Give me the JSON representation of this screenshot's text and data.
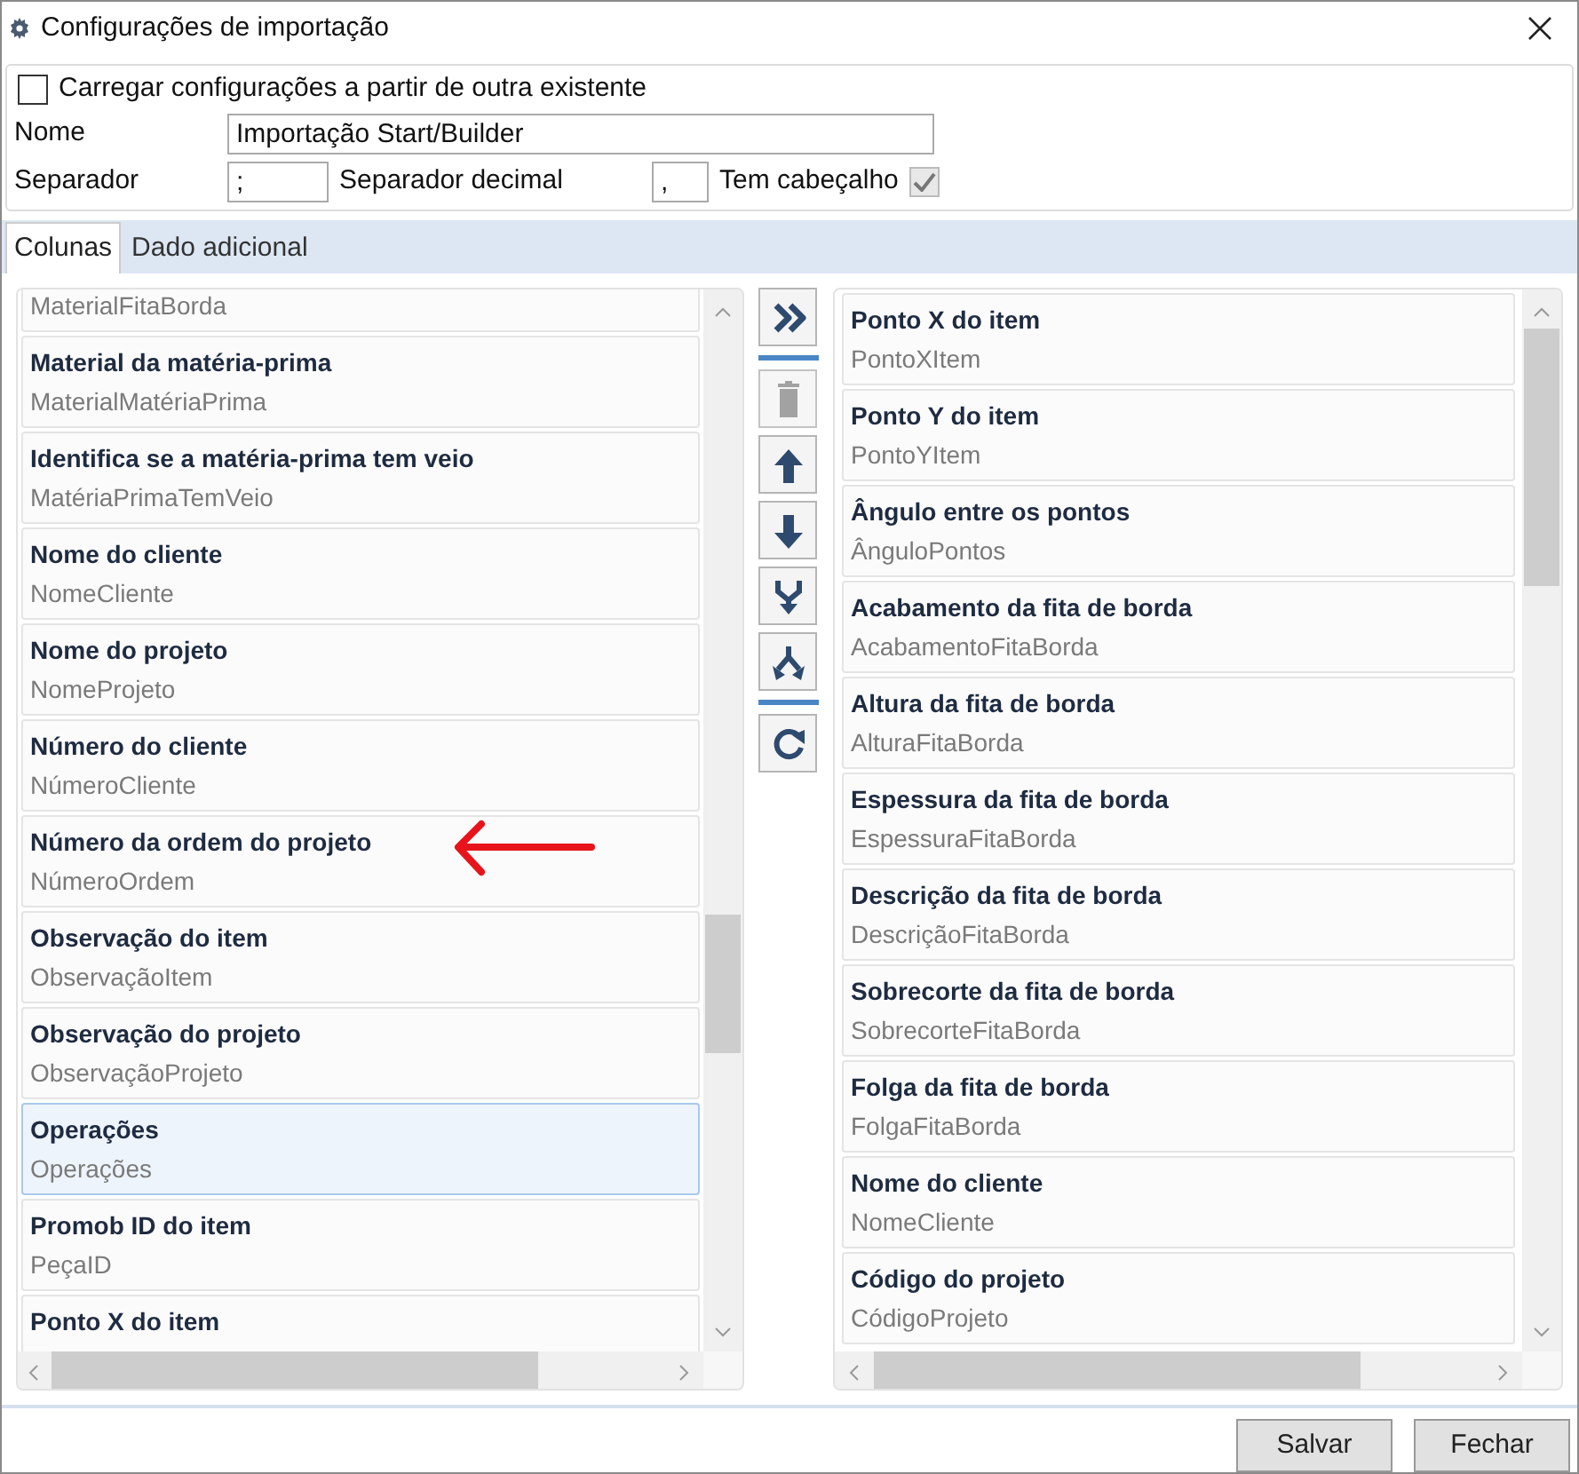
{
  "window": {
    "title": "Configurações de importação"
  },
  "load_existing": {
    "label": "Carregar configurações a partir de outra existente",
    "checked": false
  },
  "name_field": {
    "label": "Nome",
    "value": "Importação Start/Builder"
  },
  "separator": {
    "label": "Separador",
    "value": ";"
  },
  "decimal_separator": {
    "label": "Separador decimal",
    "value": ","
  },
  "has_header": {
    "label": "Tem cabeçalho",
    "checked": true
  },
  "tabs": [
    {
      "label": "Colunas",
      "selected": true
    },
    {
      "label": "Dado adicional",
      "selected": false
    }
  ],
  "available_columns": [
    {
      "field": "MaterialFitaBorda",
      "selected": false
    },
    {
      "title": "Material da matéria-prima",
      "field": "MaterialMatériaPrima",
      "selected": false
    },
    {
      "title": "Identifica se a matéria-prima tem veio",
      "field": "MatériaPrimaTemVeio",
      "selected": false
    },
    {
      "title": "Nome do cliente",
      "field": "NomeCliente",
      "selected": false
    },
    {
      "title": "Nome do projeto",
      "field": "NomeProjeto",
      "selected": false
    },
    {
      "title": "Número do cliente",
      "field": "NúmeroCliente",
      "selected": false
    },
    {
      "title": "Número da ordem do projeto",
      "field": "NúmeroOrdem",
      "selected": false,
      "arrow_marked": true
    },
    {
      "title": "Observação do item",
      "field": "ObservaçãoItem",
      "selected": false
    },
    {
      "title": "Observação do projeto",
      "field": "ObservaçãoProjeto",
      "selected": false
    },
    {
      "title": "Operações",
      "field": "Operações",
      "selected": true
    },
    {
      "title": "Promob ID do item",
      "field": "PeçaID",
      "selected": false
    },
    {
      "title": "Ponto X do item",
      "selected": false
    }
  ],
  "toolbar": [
    {
      "kind": "add_all",
      "disabled": false
    },
    {
      "kind": "separator"
    },
    {
      "kind": "delete",
      "disabled": true
    },
    {
      "kind": "up",
      "disabled": false
    },
    {
      "kind": "down",
      "disabled": false
    },
    {
      "kind": "merge",
      "disabled": false
    },
    {
      "kind": "split",
      "disabled": false
    },
    {
      "kind": "separator"
    },
    {
      "kind": "refresh",
      "disabled": false
    }
  ],
  "selected_columns": [
    {
      "title": "Ponto X do item",
      "field": "PontoXItem"
    },
    {
      "title": "Ponto Y do item",
      "field": "PontoYItem"
    },
    {
      "title": "Ângulo entre os pontos",
      "field": "ÂnguloPontos"
    },
    {
      "title": "Acabamento da fita de borda",
      "field": "AcabamentoFitaBorda"
    },
    {
      "title": "Altura da fita de borda",
      "field": "AlturaFitaBorda"
    },
    {
      "title": "Espessura da fita de borda",
      "field": "EspessuraFitaBorda"
    },
    {
      "title": "Descrição da fita de borda",
      "field": "DescriçãoFitaBorda"
    },
    {
      "title": "Sobrecorte da fita de borda",
      "field": "SobrecorteFitaBorda"
    },
    {
      "title": "Folga da fita de borda",
      "field": "FolgaFitaBorda"
    },
    {
      "title": "Nome do cliente",
      "field": "NomeCliente"
    },
    {
      "title": "Código do projeto",
      "field": "CódigoProjeto"
    }
  ],
  "buttons": [
    "Salvar",
    "Fechar"
  ]
}
